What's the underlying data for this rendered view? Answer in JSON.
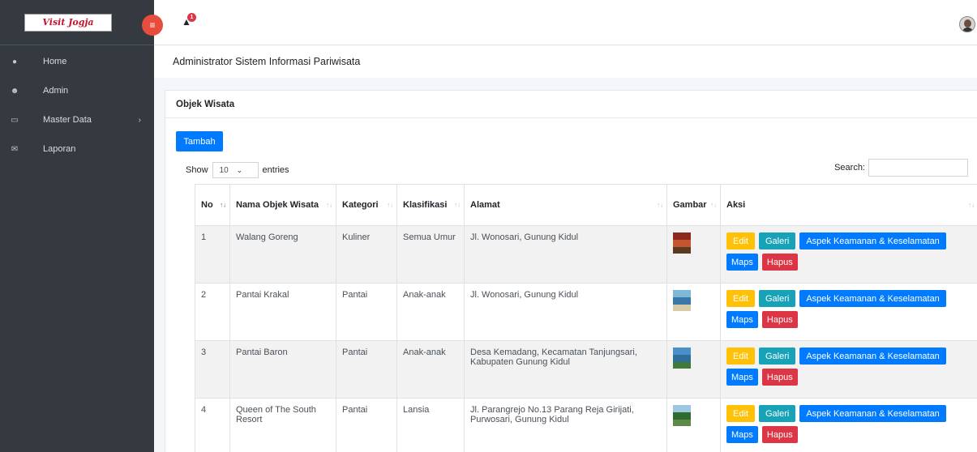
{
  "brand": {
    "logo_text": "Visit Jogja"
  },
  "sidebar": {
    "items": [
      {
        "label": "Home",
        "icon": "dashboard-icon",
        "glyph": "●"
      },
      {
        "label": "Admin",
        "icon": "users-icon",
        "glyph": "☻"
      },
      {
        "label": "Master Data",
        "icon": "laptop-icon",
        "glyph": "▭"
      },
      {
        "label": "Laporan",
        "icon": "envelope-icon",
        "glyph": "✉"
      }
    ]
  },
  "topbar": {
    "notification_count": "1"
  },
  "page": {
    "header": "Administrator Sistem Informasi Pariwisata"
  },
  "card": {
    "title": "Objek Wisata",
    "add_label": "Tambah",
    "show_label": "Show",
    "entries_value": "10",
    "entries_label": "entries",
    "search_label": "Search:"
  },
  "table": {
    "headers": {
      "no": "No",
      "nama": "Nama Objek Wisata",
      "kategori": "Kategori",
      "klasifikasi": "Klasifikasi",
      "alamat": "Alamat",
      "gambar": "Gambar",
      "aksi": "Aksi"
    },
    "actions": {
      "edit": "Edit",
      "galeri": "Galeri",
      "aspek": "Aspek Keamanan & Keselamatan",
      "maps": "Maps",
      "hapus": "Hapus"
    },
    "rows": [
      {
        "no": "1",
        "nama": "Walang Goreng",
        "kategori": "Kuliner",
        "klasifikasi": "Semua Umur",
        "alamat": "Jl. Wonosari, Gunung Kidul",
        "image_colors": [
          "#8b2a1c",
          "#c4552e",
          "#5a3a20"
        ]
      },
      {
        "no": "2",
        "nama": "Pantai Krakal",
        "kategori": "Pantai",
        "klasifikasi": "Anak-anak",
        "alamat": "Jl. Wonosari, Gunung Kidul",
        "image_colors": [
          "#7fb8d8",
          "#3b77a8",
          "#d7cba8"
        ]
      },
      {
        "no": "3",
        "nama": "Pantai Baron",
        "kategori": "Pantai",
        "klasifikasi": "Anak-anak",
        "alamat": "Desa Kemadang, Kecamatan Tanjungsari, Kabupaten Gunung Kidul",
        "image_colors": [
          "#4a90c8",
          "#2d6f9a",
          "#3f7a3a"
        ]
      },
      {
        "no": "4",
        "nama": "Queen of The South Resort",
        "kategori": "Pantai",
        "klasifikasi": "Lansia",
        "alamat": "Jl. Parangrejo No.13 Parang Reja Girijati, Purwosari, Gunung Kidul",
        "image_colors": [
          "#9fc6e0",
          "#2f6b2f",
          "#5d8a4a"
        ]
      }
    ]
  },
  "colors": {
    "sidebar_bg": "#343a40",
    "primary": "#007bff",
    "warning": "#ffc107",
    "info": "#17a2b8",
    "danger": "#dc3545",
    "toggle": "#e74c3c"
  }
}
